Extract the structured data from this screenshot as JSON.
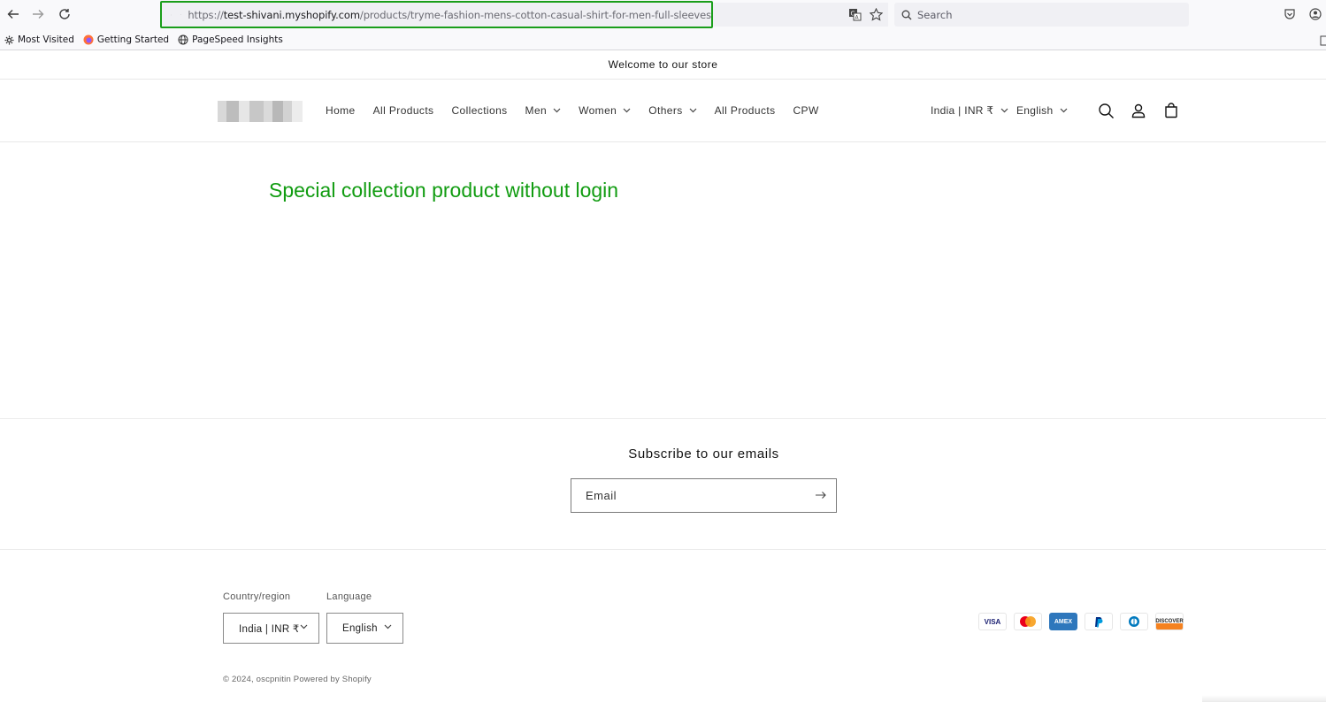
{
  "browser": {
    "url_prefix": "https://",
    "url_host": "test-shivani.myshopify.com",
    "url_path": "/products/tryme-fashion-mens-cotton-casual-shirt-for-men-full-sleeves",
    "search_placeholder": "Search",
    "bookmarks": [
      {
        "label": "Most Visited",
        "icon": "gear-icon"
      },
      {
        "label": "Getting Started",
        "icon": "firefox-icon"
      },
      {
        "label": "PageSpeed Insights",
        "icon": "globe-icon"
      }
    ]
  },
  "store": {
    "announcement": "Welcome to our store",
    "menu": [
      "Home",
      "All Products",
      "Collections",
      "Men",
      "Women",
      "Others",
      "All Products",
      "CPW"
    ],
    "country": "India | INR ₹",
    "language": "English"
  },
  "main": {
    "message": "Special collection product without login",
    "message_color": "#119c11"
  },
  "newsletter": {
    "title": "Subscribe to our emails",
    "email_placeholder": "Email"
  },
  "footer": {
    "country_label": "Country/region",
    "country_value": "India | INR ₹",
    "language_label": "Language",
    "language_value": "English",
    "payments": [
      "VISA",
      "Mastercard",
      "AMEX",
      "PayPal",
      "Diners",
      "DISCOVER"
    ],
    "copyright": "© 2024, oscpnitin Powered by Shopify"
  },
  "colors": {
    "url_highlight": "#1a9e1a"
  }
}
